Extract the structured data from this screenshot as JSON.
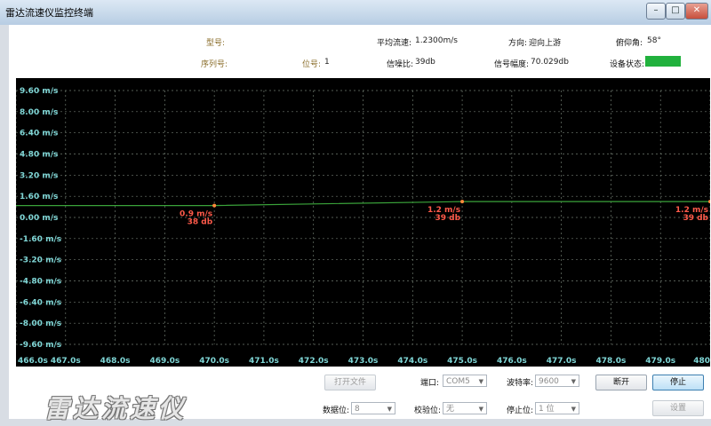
{
  "window": {
    "title": "雷达流速仪监控终端",
    "controls": {
      "minimize": "–",
      "maximize": "□",
      "close": "✕"
    }
  },
  "info": {
    "model_label": "型号:",
    "model_value": "",
    "serial_label": "序列号:",
    "serial_value": "",
    "position_label": "位号:",
    "position_value": "1",
    "avg_speed_label": "平均流速:",
    "avg_speed_value": "1.2300m/s",
    "snr_label": "信噪比:",
    "snr_value": "39db",
    "direction_label": "方向:",
    "direction_value": "迎向上游",
    "amplitude_label": "信号幅度:",
    "amplitude_value": "70.029db",
    "pitch_label": "俯仰角:",
    "pitch_value": "58°",
    "status_label": "设备状态:",
    "status_color": "#21b13d"
  },
  "chart_data": {
    "type": "line",
    "x": [
      466.0,
      470.0,
      475.0,
      480.0
    ],
    "series": [
      {
        "values": [
          0.9,
          0.9,
          1.2,
          1.2
        ]
      }
    ],
    "annotations": [
      {
        "x": 470.0,
        "speed": "0.9 m/s",
        "snr": "38 db"
      },
      {
        "x": 475.0,
        "speed": "1.2 m/s",
        "snr": "39 db"
      },
      {
        "x": 480.0,
        "speed": "1.2 m/s",
        "snr": "39 db"
      }
    ],
    "y_ticks": [
      "9.60 m/s",
      "8.00 m/s",
      "6.40 m/s",
      "4.80 m/s",
      "3.20 m/s",
      "1.60 m/s",
      "0.00 m/s",
      "-1.60 m/s",
      "-3.20 m/s",
      "-4.80 m/s",
      "-6.40 m/s",
      "-8.00 m/s",
      "-9.60 m/s"
    ],
    "x_ticks": [
      "466.0s",
      "467.0s",
      "468.0s",
      "469.0s",
      "470.0s",
      "471.0s",
      "472.0s",
      "473.0s",
      "474.0s",
      "475.0s",
      "476.0s",
      "477.0s",
      "478.0s",
      "479.0s",
      "480"
    ],
    "xlim": [
      466,
      480
    ],
    "ylim": [
      -9.6,
      9.6
    ],
    "grid": true,
    "colors": {
      "background": "#000000",
      "grid": "#6f7a6f",
      "line": "#3aa33a",
      "axis_text": "#7fd6d6",
      "annotation": "#ff5a4a",
      "point": "#ff8a3a"
    }
  },
  "bottom": {
    "logo_text": "雷达流速仪",
    "open_file_label": "打开文件",
    "port_label": "端口:",
    "port_value": "COM5",
    "baud_label": "波特率:",
    "baud_value": "9600",
    "disconnect_label": "断开",
    "stop_label": "停止",
    "databits_label": "数据位:",
    "databits_value": "8",
    "parity_label": "校验位:",
    "parity_value": "无",
    "stopbits_label": "停止位:",
    "stopbits_value": "1 位",
    "settings_label": "设置"
  }
}
